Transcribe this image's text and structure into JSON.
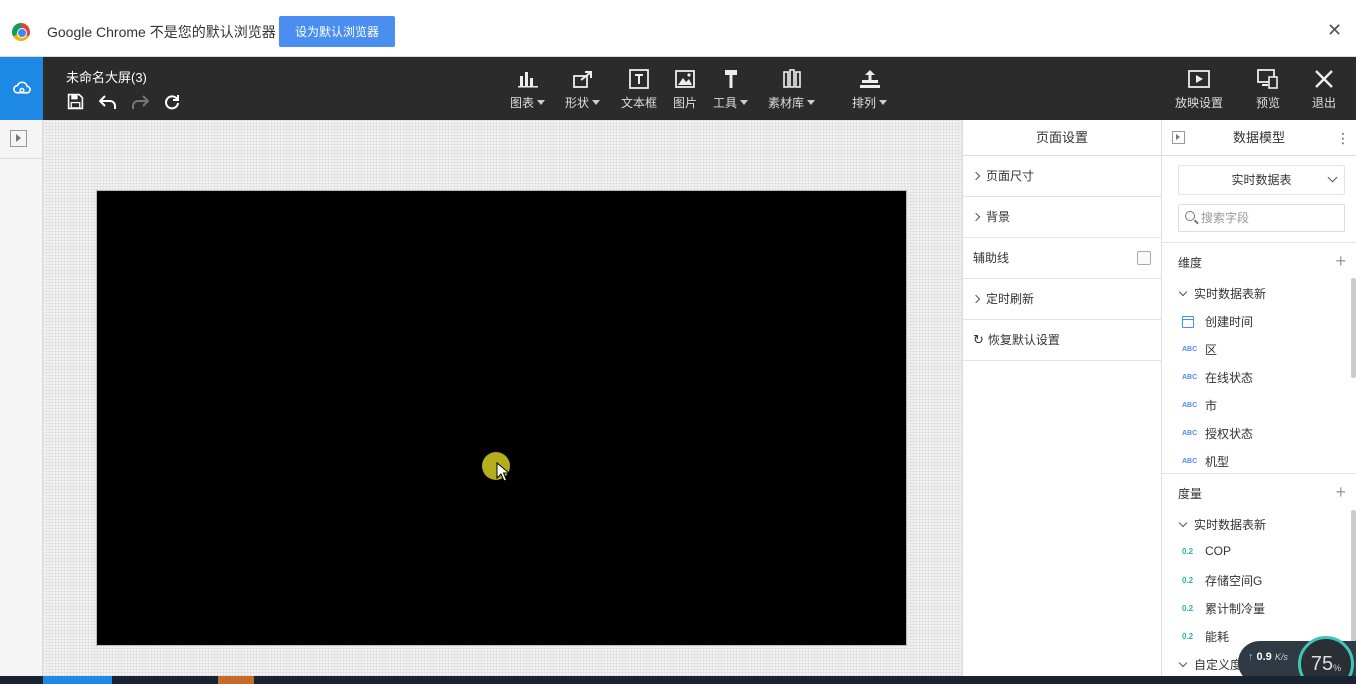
{
  "infobar": {
    "message": "Google Chrome 不是您的默认浏览器",
    "set_default_button": "设为默认浏览器",
    "close_glyph": "✕"
  },
  "toolbar": {
    "doc_title": "未命名大屏(3)",
    "buttons": {
      "chart": "图表",
      "shape": "形状",
      "textbox": "文本框",
      "image": "图片",
      "tools": "工具",
      "library": "素材库",
      "arrange": "排列",
      "play_settings": "放映设置",
      "preview": "预览",
      "exit": "退出"
    },
    "accent_color": "#1e88e5",
    "bg_color": "#2b2b2b"
  },
  "page_settings": {
    "title": "页面设置",
    "rows": {
      "page_size": "页面尺寸",
      "background": "背景",
      "guides": "辅助线",
      "auto_refresh": "定时刷新",
      "restore_defaults": "恢复默认设置"
    }
  },
  "data_model": {
    "title": "数据模型",
    "more_glyph": "⋮",
    "selected_table": "实时数据表",
    "search_placeholder": "搜索字段",
    "dimensions": {
      "title": "维度",
      "group": "实时数据表新",
      "fields": [
        {
          "type": "date",
          "name": "创建时间"
        },
        {
          "type": "ABC",
          "name": "区"
        },
        {
          "type": "ABC",
          "name": "在线状态"
        },
        {
          "type": "ABC",
          "name": "市"
        },
        {
          "type": "ABC",
          "name": "授权状态"
        },
        {
          "type": "ABC",
          "name": "机型"
        }
      ]
    },
    "measures": {
      "title": "度量",
      "group": "实时数据表新",
      "fields": [
        {
          "type": "0.2",
          "name": "COP"
        },
        {
          "type": "0.2",
          "name": "存储空间G"
        },
        {
          "type": "0.2",
          "name": "累计制冷量"
        },
        {
          "type": "0.2",
          "name": "能耗"
        }
      ],
      "group2": "自定义度"
    },
    "plus_glyph": "+"
  },
  "net_widget": {
    "speed": "0.9",
    "unit": "K/s",
    "percent": "75",
    "percent_sign": "%"
  }
}
